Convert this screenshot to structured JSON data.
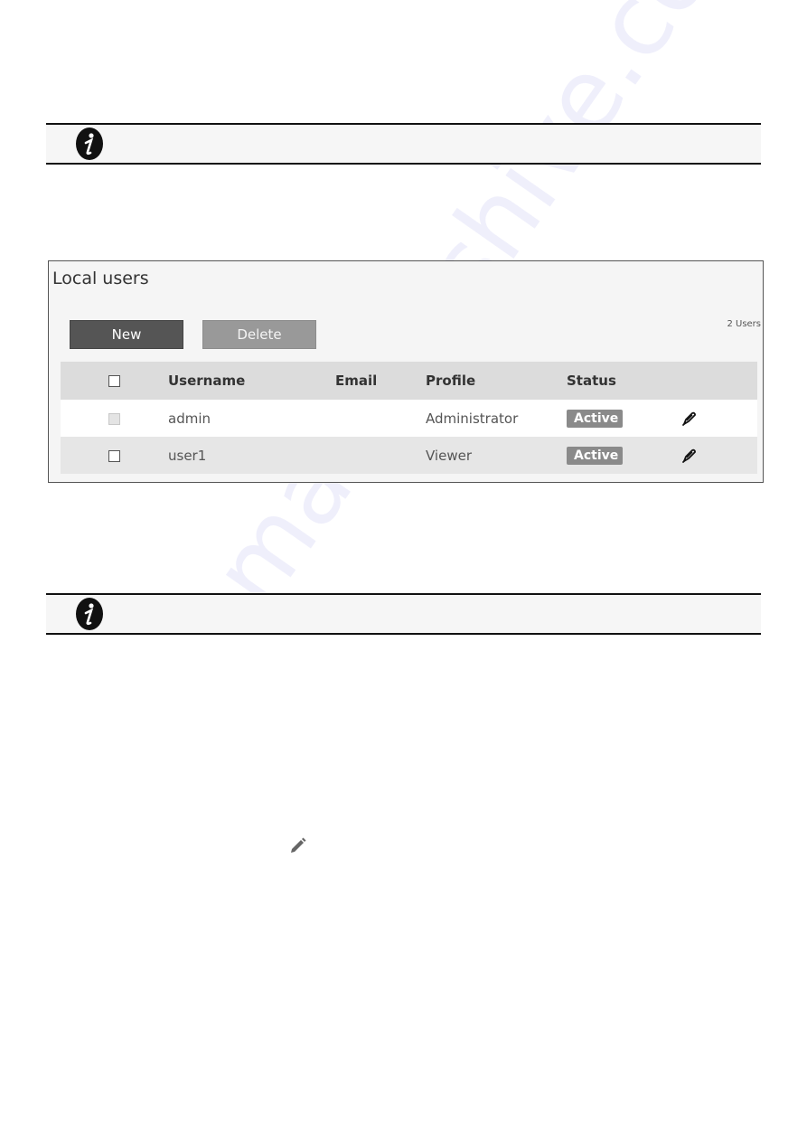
{
  "notes": [
    {
      "icon": "info-icon"
    },
    {
      "icon": "info-icon"
    }
  ],
  "panel": {
    "title": "Local users",
    "buttons": {
      "new_label": "New",
      "delete_label": "Delete"
    },
    "user_count": "2 Users",
    "table": {
      "headers": {
        "username": "Username",
        "email": "Email",
        "profile": "Profile",
        "status": "Status"
      },
      "rows": [
        {
          "username": "admin",
          "email": "",
          "profile": "Administrator",
          "status": "Active",
          "checkbox_disabled": true
        },
        {
          "username": "user1",
          "email": "",
          "profile": "Viewer",
          "status": "Active",
          "checkbox_disabled": false
        }
      ]
    }
  },
  "inline_icon": "pencil-icon",
  "watermark": "manualshive.com",
  "colors": {
    "badge": "#8a8a8a",
    "new_button": "#555555",
    "delete_button": "#999999"
  }
}
